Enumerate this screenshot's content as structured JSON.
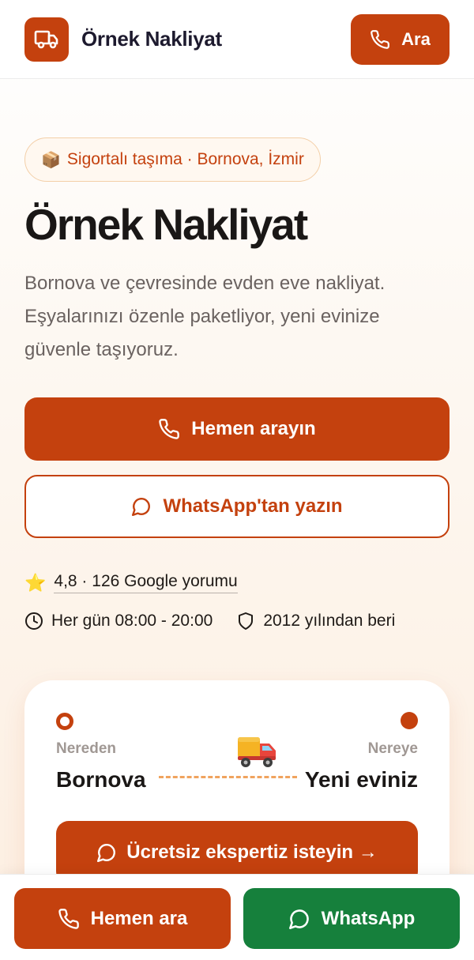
{
  "colors": {
    "brand": "#c4410e",
    "whatsapp": "#16803c",
    "badge_border": "#f3cfa8",
    "route_dash": "#f0a35e"
  },
  "header": {
    "logo_icon": "truck-icon",
    "brand_name": "Örnek Nakliyat",
    "call_label": "Ara",
    "call_icon": "phone-icon"
  },
  "hero": {
    "badge_icon": "📦",
    "badge_text": "Sigortalı taşıma · Bornova, İzmir",
    "title": "Örnek Nakliyat",
    "description": "Bornova ve çevresinde evden eve nakliyat. Eşyalarınızı özenle paketliyor, yeni evinize güvenle taşıyoruz.",
    "primary_cta": "Hemen arayın",
    "secondary_cta": "WhatsApp'tan yazın"
  },
  "trust": {
    "star_icon": "⭐",
    "rating_text": "4,8 · 126 Google yorumu",
    "hours_icon": "clock-icon",
    "hours_text": "Her gün 08:00 - 20:00",
    "since_icon": "shield-icon",
    "since_text": "2012 yılından beri"
  },
  "route_card": {
    "from_label": "Nereden",
    "from_value": "Bornova",
    "to_label": "Nereye",
    "to_value": "Yeni eviniz",
    "cta": "Ücretsiz ekspertiz isteyin →"
  },
  "bottom_bar": {
    "call_label": "Hemen ara",
    "whatsapp_label": "WhatsApp"
  }
}
